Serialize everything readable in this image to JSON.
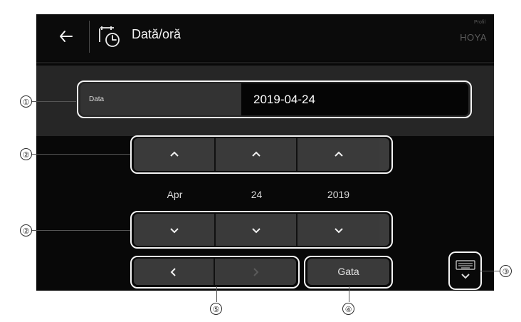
{
  "header": {
    "title": "Dată/oră",
    "profile_label": "Profil",
    "profile_name": "HOYA",
    "back_icon": "arrow-left-icon",
    "clock_icon": "clock-calendar-icon"
  },
  "date_field": {
    "label": "Data",
    "value": "2019-04-24"
  },
  "date_picker": {
    "columns": [
      {
        "value": "Apr",
        "up_icon": "chevron-up-icon",
        "down_icon": "chevron-down-icon"
      },
      {
        "value": "24",
        "up_icon": "chevron-up-icon",
        "down_icon": "chevron-down-icon"
      },
      {
        "value": "2019",
        "up_icon": "chevron-up-icon",
        "down_icon": "chevron-down-icon"
      }
    ]
  },
  "actions": {
    "previous_icon": "chevron-left-icon",
    "next_icon": "chevron-right-icon",
    "done_label": "Gata",
    "keyboard_icon": "keyboard-icon"
  },
  "callouts": {
    "date_field_number": "①",
    "increment_number": "②",
    "decrement_number": "②",
    "keyboard_number": "③",
    "done_number": "④",
    "navigation_number": "⑤"
  },
  "colors": {
    "background": "#080808",
    "panel": "#262626",
    "button": "#3a3a3a",
    "highlight": "#f4f4f4",
    "text": "#f5f5f5"
  }
}
